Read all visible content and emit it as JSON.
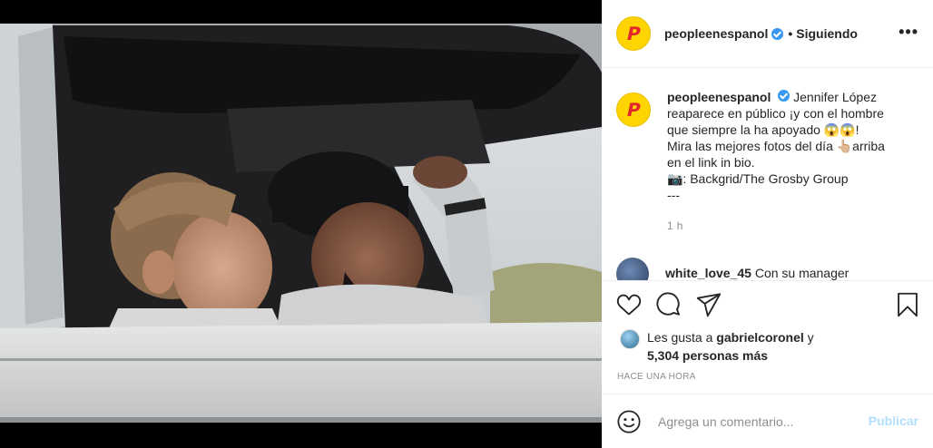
{
  "colors": {
    "brand_yellow": "#ffd400",
    "brand_red": "#e3262c",
    "verified_blue": "#3897f0",
    "publish_disabled": "#b2dffc",
    "muted": "#8e8e8e"
  },
  "media": {
    "icon": "car-photo"
  },
  "header": {
    "logo_letter": "P",
    "username": "peopleenespanol",
    "separator": "•",
    "follow_status": "Siguiendo",
    "more_label": "•••"
  },
  "caption": {
    "username": "peopleenespanol",
    "line1": "Jennifer López reaparece en público ¡y con el hombre que siempre la ha apoyado 😱😱!",
    "line2": "Mira las mejores fotos del día 👆🏼arriba en el link in bio.",
    "line3": "📷: Backgrid/The Grosby Group",
    "line4": "---",
    "time": "1 h"
  },
  "next_comment": {
    "username": "white_love_45",
    "text": "Con su manager"
  },
  "actions": {
    "like_icon": "heart-icon",
    "comment_icon": "comment-icon",
    "share_icon": "share-icon",
    "save_icon": "bookmark-icon"
  },
  "likes": {
    "prefix": "Les gusta a ",
    "user": "gabrielcoronel",
    "connector": " y",
    "count": "5,304 personas más"
  },
  "posted_ago": "HACE UNA HORA",
  "comment_box": {
    "placeholder": "Agrega un comentario...",
    "publish_label": "Publicar"
  }
}
